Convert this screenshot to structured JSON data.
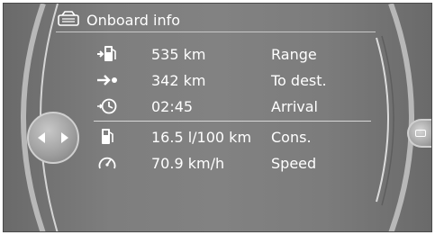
{
  "header": {
    "title": "Onboard info",
    "icon": "car-computer-icon"
  },
  "rows": [
    {
      "icon": "fuel-range-icon",
      "value": "535 km",
      "label": "Range"
    },
    {
      "icon": "destination-arrow-icon",
      "value": "342 km",
      "label": "To dest."
    },
    {
      "icon": "arrival-clock-icon",
      "value": "02:45",
      "label": "Arrival"
    },
    {
      "icon": "fuel-pump-icon",
      "value": "16.5 l/100 km",
      "label": "Cons."
    },
    {
      "icon": "speedometer-icon",
      "value": "70.9 km/h",
      "label": "Speed"
    }
  ],
  "colors": {
    "background": "#7e7e7e",
    "text": "#ffffff",
    "divider": "#d8d8d8"
  }
}
